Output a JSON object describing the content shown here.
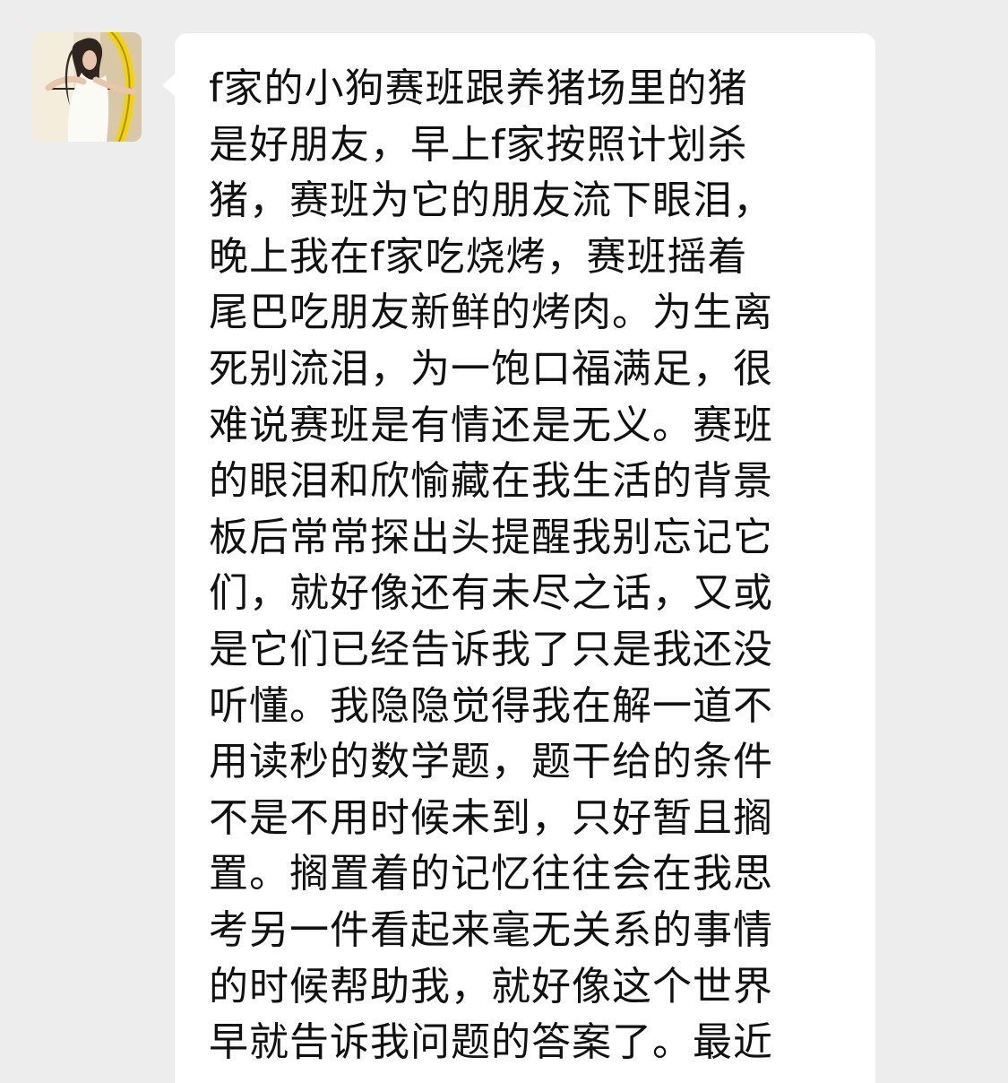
{
  "chat": {
    "avatar_icon": "profile-photo-archer-icon",
    "bubble_color": "#ffffff",
    "background_color": "#ededed",
    "message_lines": [
      "f家的小狗赛班跟养猪场里的猪",
      "是好朋友，早上f家按照计划杀",
      "猪，赛班为它的朋友流下眼泪，",
      "晚上我在f家吃烧烤，赛班摇着",
      "尾巴吃朋友新鲜的烤肉。为生离",
      "死别流泪，为一饱口福满足，很",
      "难说赛班是有情还是无义。赛班",
      "的眼泪和欣愉藏在我生活的背景",
      "板后常常探出头提醒我别忘记它",
      "们，就好像还有未尽之话，又或",
      "是它们已经告诉我了只是我还没",
      "听懂。我隐隐觉得我在解一道不",
      "用读秒的数学题，题干给的条件",
      "不是不用时候未到，只好暂且搁",
      "置。搁置着的记忆往往会在我思",
      "考另一件看起来毫无关系的事情",
      "的时候帮助我，就好像这个世界",
      "早就告诉我问题的答案了。最近"
    ]
  }
}
